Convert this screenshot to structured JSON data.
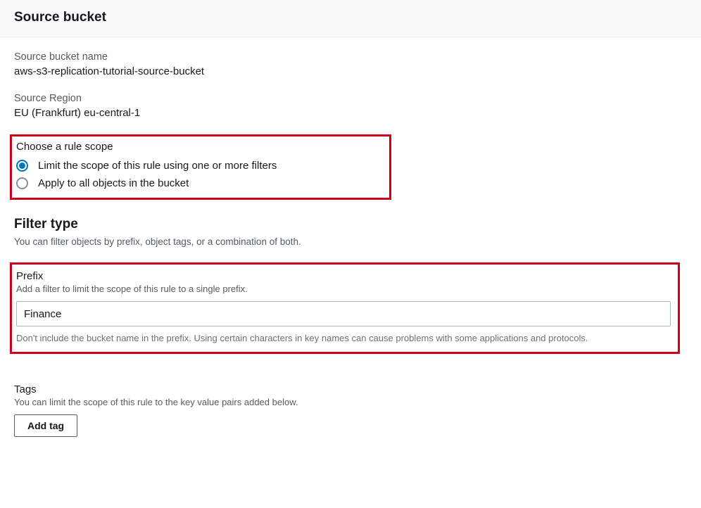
{
  "header": {
    "title": "Source bucket"
  },
  "source": {
    "name_label": "Source bucket name",
    "name_value": "aws-s3-replication-tutorial-source-bucket",
    "region_label": "Source Region",
    "region_value": "EU (Frankfurt) eu-central-1"
  },
  "scope": {
    "title": "Choose a rule scope",
    "options": {
      "filters": "Limit the scope of this rule using one or more filters",
      "all": "Apply to all objects in the bucket"
    },
    "selected": "filters"
  },
  "filter": {
    "heading": "Filter type",
    "desc": "You can filter objects by prefix, object tags, or a combination of both."
  },
  "prefix": {
    "label": "Prefix",
    "desc": "Add a filter to limit the scope of this rule to a single prefix.",
    "value": "Finance",
    "hint": "Don't include the bucket name in the prefix. Using certain characters in key names can cause problems with some applications and protocols."
  },
  "tags": {
    "label": "Tags",
    "desc": "You can limit the scope of this rule to the key value pairs added below.",
    "add_button": "Add tag"
  }
}
